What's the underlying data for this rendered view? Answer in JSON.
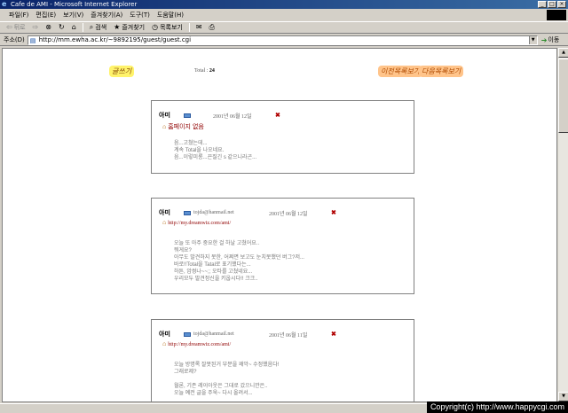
{
  "window": {
    "title": "Cafe de AMI - Microsoft Internet Explorer"
  },
  "menu": [
    "파일(F)",
    "편집(E)",
    "보기(V)",
    "즐겨찾기(A)",
    "도구(T)",
    "도움말(H)"
  ],
  "toolbar": {
    "back": "뒤로",
    "search": "검색",
    "favorites": "즐겨찾기",
    "history": "목록보기"
  },
  "address": {
    "label": "주소(D)",
    "url": "http://mm.ewha.ac.kr/~9892195/guest/guest.cgi",
    "go": "이동"
  },
  "page": {
    "home_link": "글쓰기",
    "total_label": "Total : ",
    "total_value": "24",
    "prev_link": "이전목록보기",
    "next_link": "다음목록보기"
  },
  "entries": [
    {
      "name": "아미",
      "email": "",
      "date": "2001년 06월 12일",
      "homepage": "홈페이지 없음",
      "message": [
        "음...고쳤는데...",
        "계속 Total을 나오네요.",
        "음...이렇미롱...끈질긴 s 같으니라곤..."
      ]
    },
    {
      "name": "아미",
      "email": "tojda@hanmail.net",
      "date": "2001년 06월 12일",
      "homepage": "http://my.dreamwiz.com/ami/",
      "message": [
        "오늘 또 아주 중요한 걸 하날 고쳤어요..",
        "뭐게요?",
        "아무도 발견하지 못한, 어쩌면 보고도 눈치못챘던 버그?저...",
        "바로!!Total을 Tatal로 표기했다는...",
        "하튼, 암썽나~~;; 오타를 고쳤네요...",
        "우리모두 발견정신을 키웁시다!! 크크.."
      ]
    },
    {
      "name": "아미",
      "email": "tojda@hanmail.net",
      "date": "2001년 06월 11일",
      "homepage": "http://my.dreamwiz.com/ami/",
      "message": [
        "오늘 방명록 잘못된거 부분을 꽤악~ 수정했음다!",
        "그래로제?",
        "",
        "월론, 기존 레이아웃은 그대로 갔으니깐은..",
        "오늘 예전 글을 주욱~ 다시 올려서..."
      ]
    }
  ],
  "watermark": "Copyright(c) http://www.happycgi.com"
}
